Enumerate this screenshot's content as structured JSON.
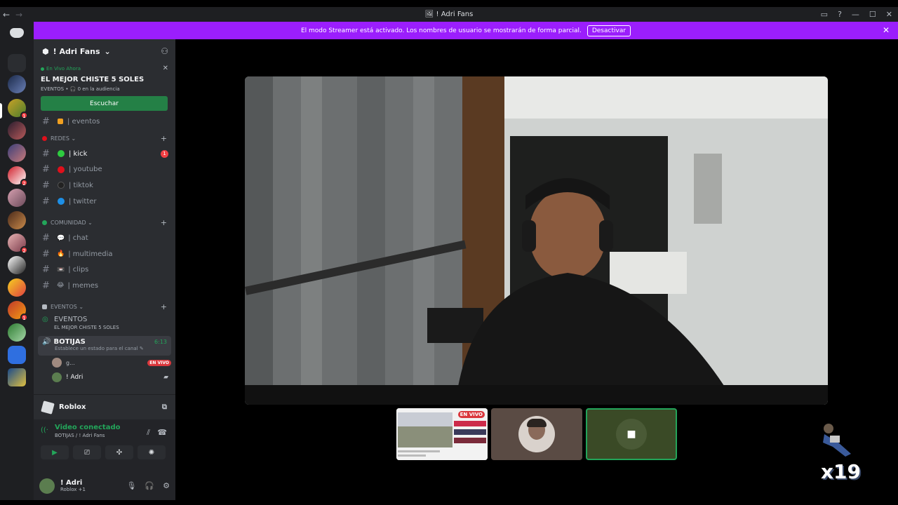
{
  "window": {
    "title": "! Adri Fans"
  },
  "banner": {
    "message": "El modo Streamer está activado. Los nombres de usuario se mostrarán de forma parcial.",
    "button": "Desactivar"
  },
  "server": {
    "name": "! Adri Fans"
  },
  "live": {
    "status": "En Vivo Ahora",
    "title": "EL MEJOR CHISTE 5 SOLES",
    "sub": "EVENTOS • 🎧 0 en la audiencia",
    "button": "Escuchar"
  },
  "partial_channel": "| eventos",
  "categories": [
    {
      "name": "REDES",
      "channels": [
        {
          "label": "| kick",
          "color": "#2ecc40",
          "mention": "1",
          "active": true
        },
        {
          "label": "| youtube",
          "color": "#e0101b"
        },
        {
          "label": "| tiktok",
          "color": "#222222"
        },
        {
          "label": "| twitter",
          "color": "#1d8fe6"
        }
      ]
    },
    {
      "name": "COMUNIDAD",
      "channels": [
        {
          "label": "| chat",
          "icon": "💬"
        },
        {
          "label": "| multimedia",
          "icon": "🔥"
        },
        {
          "label": "| clips",
          "icon": "📼"
        },
        {
          "label": "| memes",
          "icon": "😂"
        }
      ]
    }
  ],
  "events_category": {
    "name": "EVENTOS",
    "stage_name": "EVENTOS",
    "stage_sub": "EL MEJOR CHISTE 5 SOLES"
  },
  "voice_channel": {
    "name": "BOTIJAS",
    "time": "6:13",
    "status_placeholder": "Establece un estado para el canal",
    "users": [
      {
        "name": "g...",
        "badge": "EN VIVO"
      },
      {
        "name": "! Adri"
      }
    ]
  },
  "activity": {
    "name": "Roblox"
  },
  "voice_panel": {
    "title": "Video conectado",
    "sub": "BOTIJAS / ! Adri Fans"
  },
  "user": {
    "name": "! Adri",
    "sub": "Roblox +1"
  },
  "tiles": {
    "live_badge": "EN VIVO"
  },
  "overlay": {
    "counter": "x19"
  },
  "colors": {
    "brand": "#5865f2",
    "banner": "#9b1efc",
    "green": "#23a55a",
    "red": "#f23f43"
  }
}
